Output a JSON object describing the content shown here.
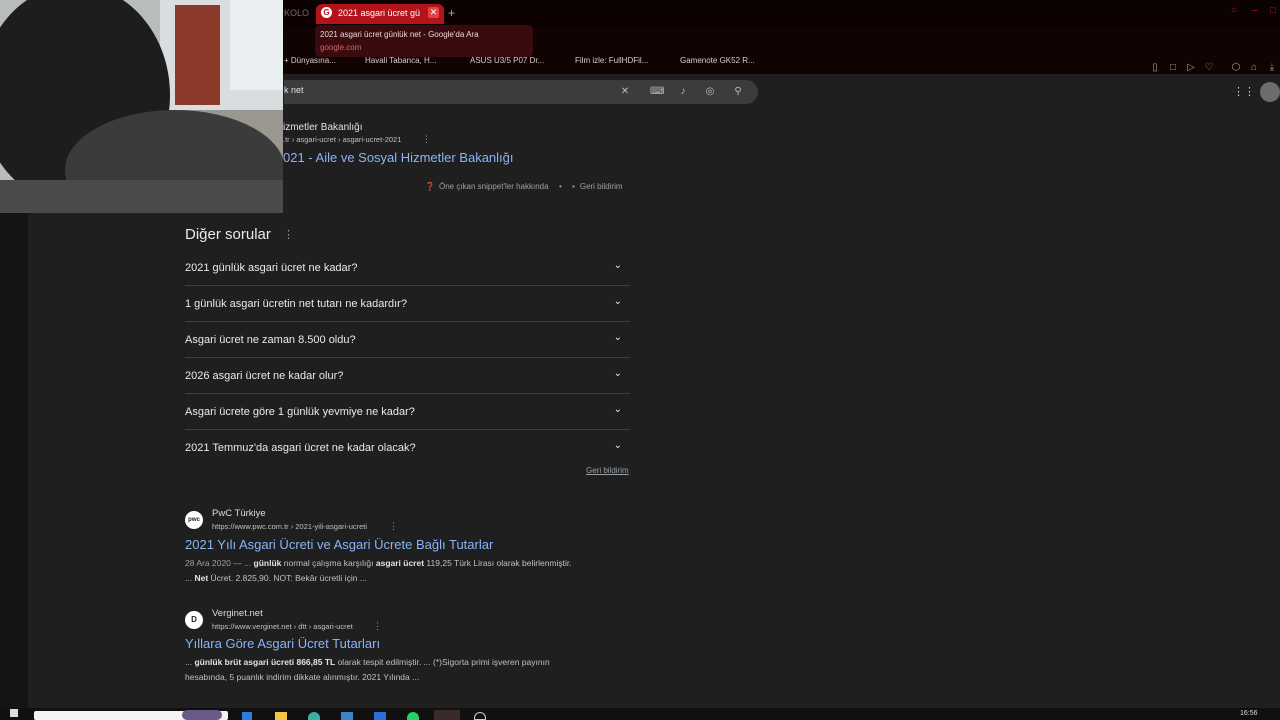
{
  "browser": {
    "prev_tab": "KOLO",
    "active_tab": "2021 asgari ücret gü",
    "tab_favicon": "G",
    "close_glyph": "✕",
    "new_tab_glyph": "+",
    "tooltip_title": "2021 asgari ücret günlük net - Google'da Ara",
    "tooltip_url": "google.com",
    "bookmarks": [
      "+ Dünyasına...",
      "Havali Tabanca, H...",
      "ASUS U3/5 P07 Dr...",
      "Film izle: FullHDFil...",
      "Gamenote GK52 R..."
    ]
  },
  "search": {
    "value": "k net",
    "clear_glyph": "✕"
  },
  "snippet": {
    "source": "izmetler Bakanlığı",
    "url": ".tr › asgari-ucret › asgari-ucret-2021",
    "title": "021 - Aile ve Sosyal Hizmetler Bakanlığı",
    "info": "Öne çıkan snippet'ler hakkında",
    "separator": "•",
    "feedback": "Geri bildirim"
  },
  "paa": {
    "heading": "Diğer sorular",
    "menu_glyph": "⋮",
    "chevron": "⌄",
    "questions": [
      "2021 günlük asgari ücret ne kadar?",
      "1 günlük asgari ücretin net tutarı ne kadardır?",
      "Asgari ücret ne zaman 8.500 oldu?",
      "2026 asgari ücret ne kadar olur?",
      "Asgari ücrete göre 1 günlük yevmiye ne kadar?",
      "2021 Temmuz'da asgari ücret ne kadar olacak?"
    ],
    "feedback": "Geri bildirim"
  },
  "results": [
    {
      "favicon": "pwc",
      "site": "PwC Türkiye",
      "url": "https://www.pwc.com.tr › 2021-yili-asgari-ucreti",
      "title": "2021 Yılı Asgari Ücreti ve Asgari Ücrete Bağlı Tutarlar",
      "date": "28 Ara 2020 — ... ",
      "snip_b1": "günlük",
      "snip_t1": " normal çalışma karşılığı ",
      "snip_b2": "asgari ücret",
      "snip_t2": " 119,25 Türk Lirası olarak belirlenmiştir.",
      "snip_l2a": "... ",
      "snip_b3": "Net",
      "snip_l2b": " Ücret. 2.825,90. NOT: Bekâr ücretli için ..."
    },
    {
      "favicon": "D",
      "site": "Verginet.net",
      "url": "https://www.verginet.net › dtt › asgari-ucret",
      "title": "Yıllara Göre Asgari Ücret Tutarları",
      "snip_l1a": "... ",
      "snip_b1": "günlük brüt asgari ücreti 866,85 TL",
      "snip_l1b": " olarak tespit edilmiştir. ... (*)Sigorta primi işveren payının",
      "snip_l2": "hesabında, 5 puanlık indirim dikkate alınmıştır. 2021 Yılında ..."
    }
  ],
  "taskbar": {
    "clock": "16:56"
  },
  "colors": {
    "accent": "#b3141b",
    "link": "#8ab4f8",
    "background": "#1f1f1f"
  }
}
